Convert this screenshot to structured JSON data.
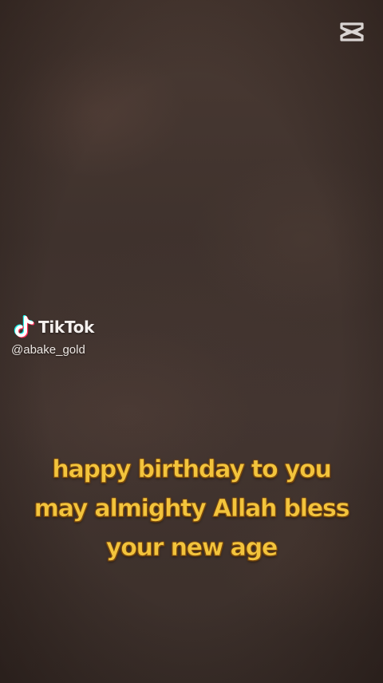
{
  "video": {
    "editor_watermark_icon": "capcut-logo-icon",
    "platform_icon": "tiktok-note-icon",
    "platform_name": "TikTok",
    "username": "@abake_gold",
    "caption_lines": [
      "happy birthday to you",
      "may almighty Allah bless",
      "your new age"
    ]
  },
  "colors": {
    "background": "#3e322c",
    "caption_fill": "#f3c43c",
    "caption_outline": "#7a4a10",
    "watermark_text": "#f4f0ee",
    "tiktok_cyan": "#25f4ee",
    "tiktok_red": "#fe2c55"
  }
}
